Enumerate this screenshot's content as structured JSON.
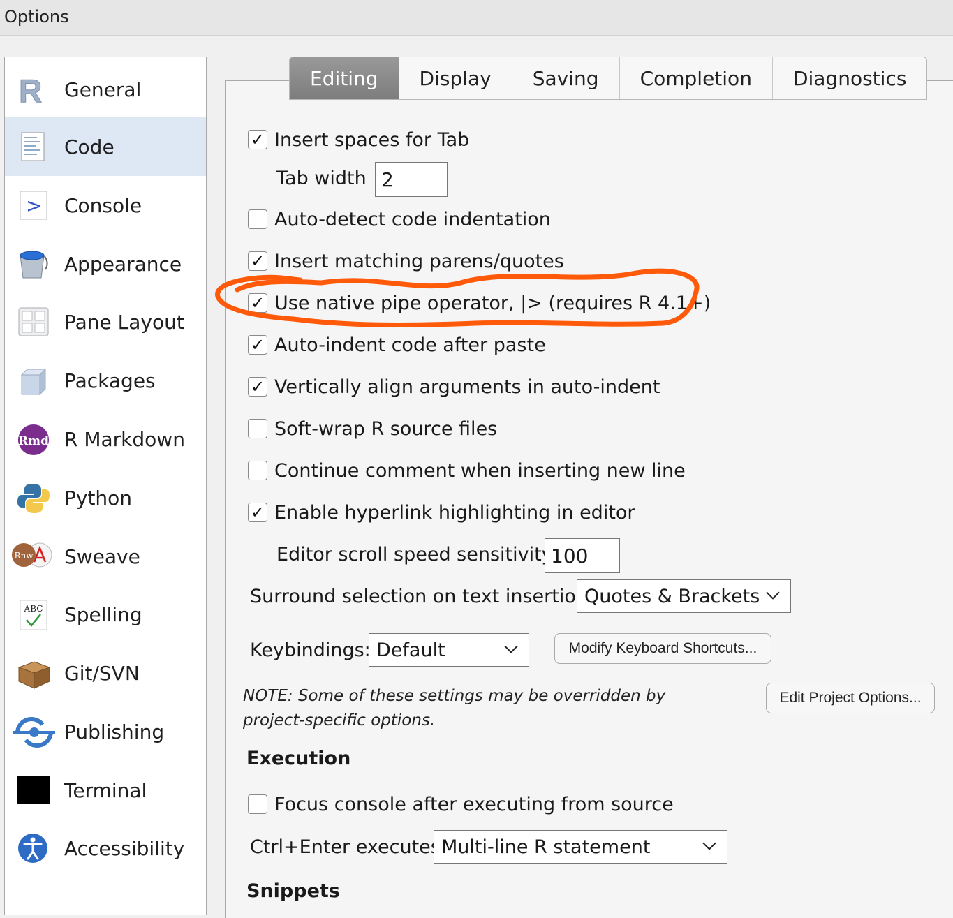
{
  "window": {
    "title": "Options"
  },
  "sidebar": {
    "items": [
      {
        "label": "General",
        "icon": "r-logo-icon",
        "selected": false
      },
      {
        "label": "Code",
        "icon": "code-file-icon",
        "selected": true
      },
      {
        "label": "Console",
        "icon": "console-prompt-icon",
        "selected": false
      },
      {
        "label": "Appearance",
        "icon": "paint-bucket-icon",
        "selected": false
      },
      {
        "label": "Pane Layout",
        "icon": "pane-grid-icon",
        "selected": false
      },
      {
        "label": "Packages",
        "icon": "package-cube-icon",
        "selected": false
      },
      {
        "label": "R Markdown",
        "icon": "rmd-icon",
        "selected": false
      },
      {
        "label": "Python",
        "icon": "python-icon",
        "selected": false
      },
      {
        "label": "Sweave",
        "icon": "sweave-icon",
        "selected": false
      },
      {
        "label": "Spelling",
        "icon": "spelling-icon",
        "selected": false
      },
      {
        "label": "Git/SVN",
        "icon": "box-icon",
        "selected": false
      },
      {
        "label": "Publishing",
        "icon": "publishing-icon",
        "selected": false
      },
      {
        "label": "Terminal",
        "icon": "terminal-icon",
        "selected": false
      },
      {
        "label": "Accessibility",
        "icon": "accessibility-icon",
        "selected": false
      }
    ],
    "icon_text": {
      "rmd": "Rmd",
      "rnw": "Rnw",
      "spelling": "ABC",
      "console": ">"
    }
  },
  "tabs": [
    {
      "label": "Editing",
      "active": true
    },
    {
      "label": "Display",
      "active": false
    },
    {
      "label": "Saving",
      "active": false
    },
    {
      "label": "Completion",
      "active": false
    },
    {
      "label": "Diagnostics",
      "active": false
    }
  ],
  "editing": {
    "insert_spaces": {
      "label": "Insert spaces for Tab",
      "checked": true
    },
    "tab_width": {
      "label": "Tab width",
      "value": "2"
    },
    "auto_detect": {
      "label": "Auto-detect code indentation",
      "checked": false
    },
    "matching_parens": {
      "label": "Insert matching parens/quotes",
      "checked": true
    },
    "native_pipe": {
      "label": "Use native pipe operator, |> (requires R 4.1+)",
      "checked": true
    },
    "auto_indent_paste": {
      "label": "Auto-indent code after paste",
      "checked": true
    },
    "vertical_align": {
      "label": "Vertically align arguments in auto-indent",
      "checked": true
    },
    "soft_wrap": {
      "label": "Soft-wrap R source files",
      "checked": false
    },
    "continue_comment": {
      "label": "Continue comment when inserting new line",
      "checked": false
    },
    "hyperlink": {
      "label": "Enable hyperlink highlighting in editor",
      "checked": true
    },
    "scroll_speed": {
      "label": "Editor scroll speed sensitivity",
      "value": "100"
    },
    "surround": {
      "label": "Surround selection on text insertion:",
      "value": "Quotes & Brackets"
    },
    "keybindings": {
      "label": "Keybindings:",
      "value": "Default"
    },
    "modify_shortcuts_button": "Modify Keyboard Shortcuts...",
    "edit_project_button": "Edit Project Options...",
    "note": "NOTE: Some of these settings may be overridden by project-specific options."
  },
  "execution": {
    "heading": "Execution",
    "focus_console": {
      "label": "Focus console after executing from source",
      "checked": false
    },
    "ctrl_enter": {
      "label": "Ctrl+Enter executes:",
      "value": "Multi-line R statement"
    }
  },
  "snippets": {
    "heading": "Snippets"
  },
  "colors": {
    "annotation": "#ff5a0a",
    "selected_bg": "#dde8f4",
    "active_tab": "#8a8a8a"
  },
  "check_glyph": "✓"
}
